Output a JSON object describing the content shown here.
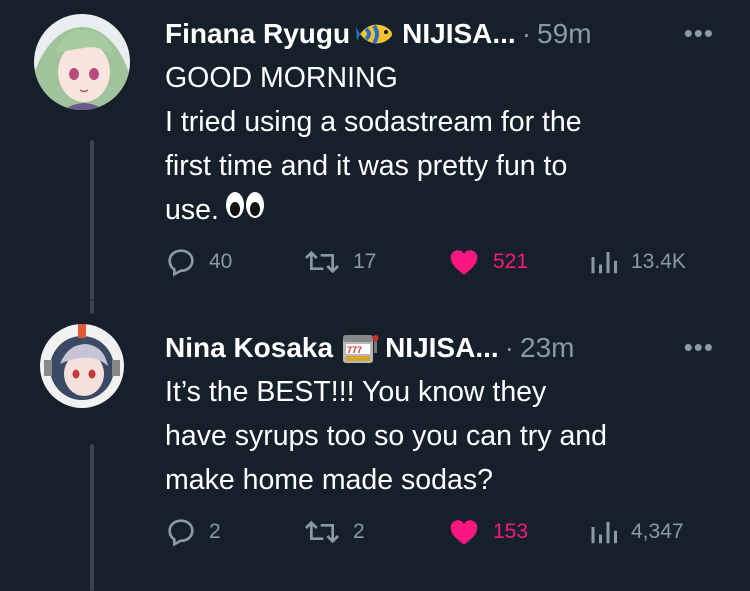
{
  "tweets": [
    {
      "name": "Finana Ryugu",
      "name_emoji": "tropical-fish-emoji",
      "handle": "NIJISA...",
      "time": "59m",
      "more_label": "•••",
      "text_lines": [
        "GOOD MORNING",
        "I tried using a sodastream for the",
        "first time and it was pretty fun to",
        "use."
      ],
      "trailing_emoji": "eyes-emoji",
      "replies": "40",
      "retweets": "17",
      "likes": "521",
      "views": "13.4K"
    },
    {
      "name": "Nina Kosaka",
      "name_emoji": "slot-machine-emoji",
      "handle": "NIJISA...",
      "time": "23m",
      "more_label": "•••",
      "text_lines": [
        "It’s the BEST!!! You know they",
        "have syrups too so you can try and",
        "make home made sodas?"
      ],
      "replies": "2",
      "retweets": "2",
      "likes": "153",
      "views": "4,347"
    }
  ],
  "colors": {
    "background": "#15202b",
    "text": "#ffffff",
    "secondary": "#8b98a5",
    "like": "#f91880",
    "thread_line": "#3a444c"
  }
}
